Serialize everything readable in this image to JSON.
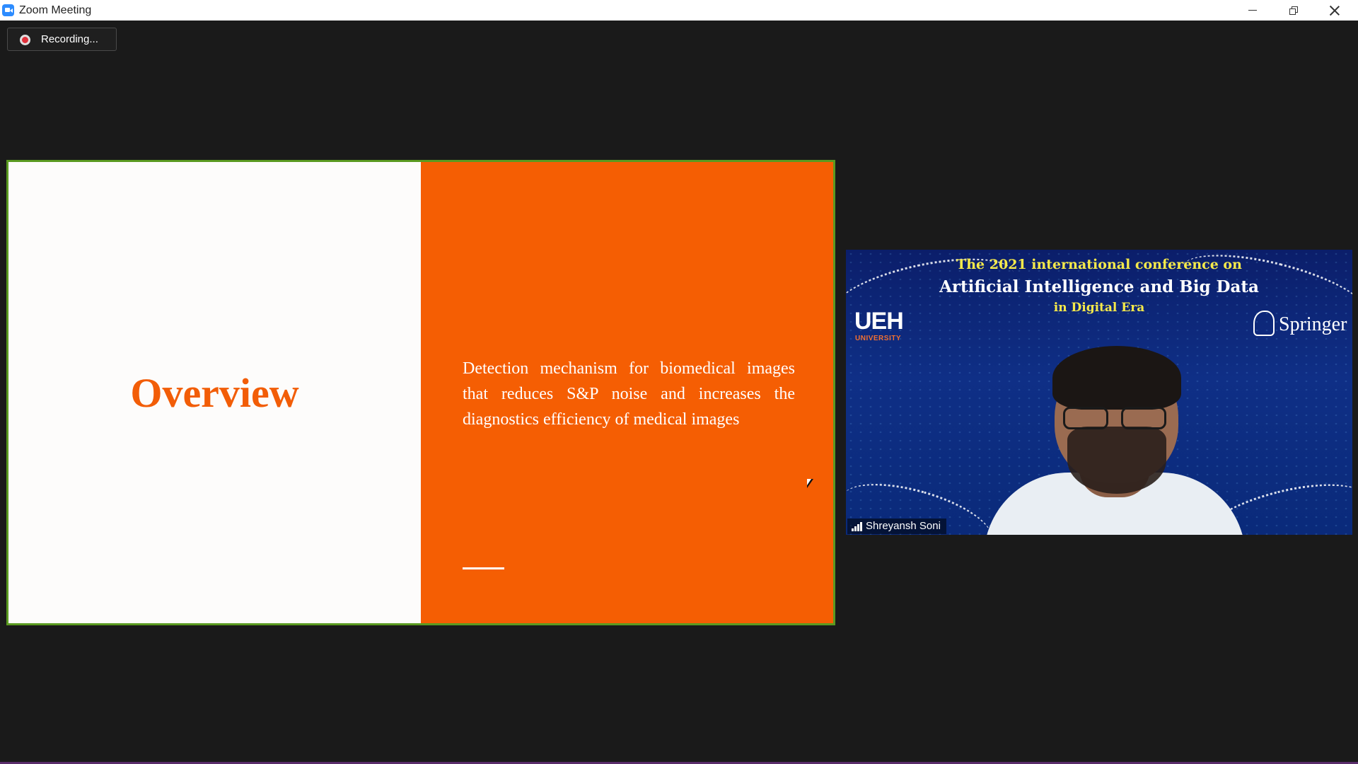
{
  "window": {
    "title": "Zoom Meeting"
  },
  "recording": {
    "label": "Recording..."
  },
  "slide": {
    "title": "Overview",
    "body": "Detection mechanism for biomedical images that reduces S&P noise and increases the diagnostics efficiency of medical images"
  },
  "participant": {
    "name": "Shreyansh Soni",
    "background": {
      "line1": "The 2021 international conference on",
      "line2": "Artificial Intelligence and Big Data",
      "line3": "in Digital Era",
      "logo_left": "UEH",
      "logo_left_sub": "UNIVERSITY",
      "logo_right": "Springer"
    }
  },
  "colors": {
    "slide_accent": "#f55e03",
    "slide_border": "#5a9a20",
    "background": "#1a1a1a"
  },
  "icons": [
    "zoom-app-icon",
    "minimize-icon",
    "restore-icon",
    "close-icon",
    "record-icon",
    "signal-icon",
    "mouse-cursor-icon"
  ]
}
